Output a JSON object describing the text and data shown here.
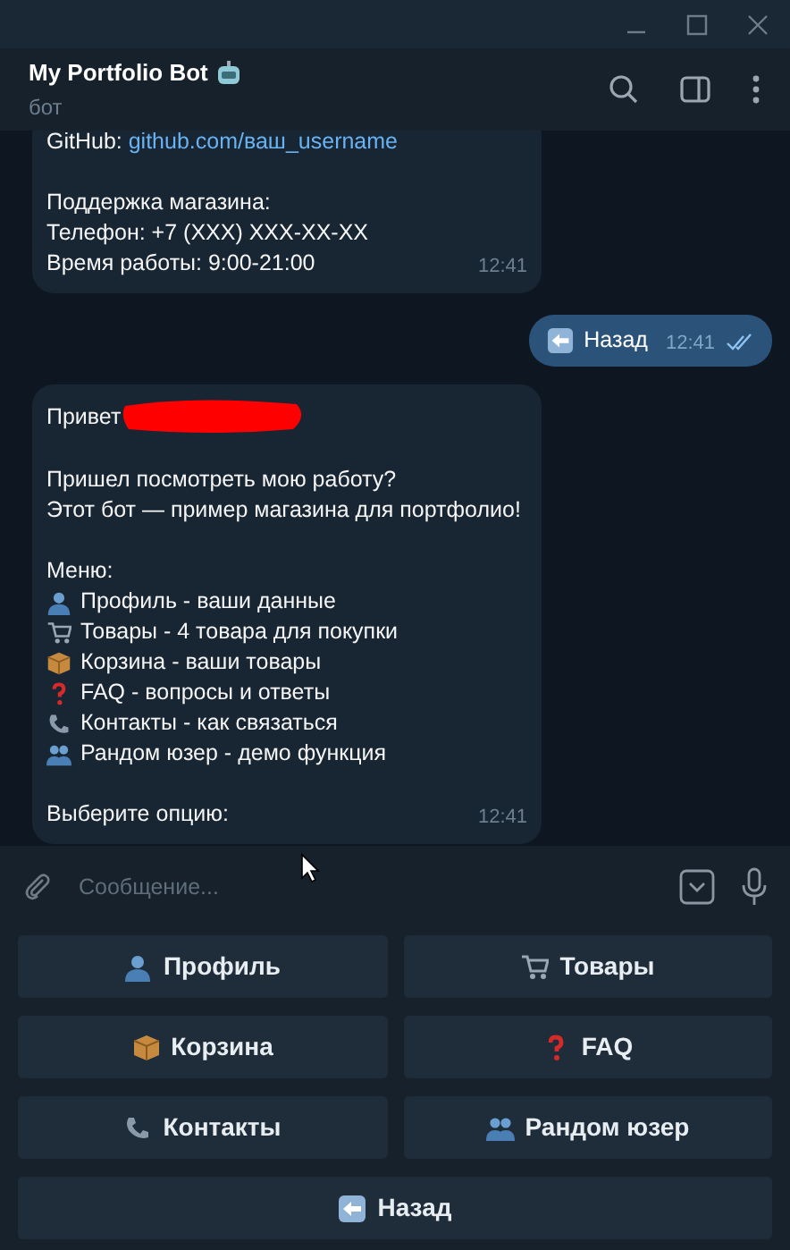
{
  "chat": {
    "title": "My Portfolio Bot",
    "subtitle": "бот"
  },
  "messages": [
    {
      "kind": "incoming",
      "paragraphs": [
        {
          "kind": "text",
          "lines": [
            {
              "text": "GitHub: ",
              "link": "github.com/ваш_username"
            }
          ]
        },
        {
          "kind": "text",
          "lines": [
            {
              "text": "Поддержка магазина:"
            },
            {
              "text": "Телефон: +7 (XXX) XXX-XX-XX"
            },
            {
              "text": "Время работы: 9:00-21:00"
            }
          ]
        }
      ],
      "time": "12:41"
    },
    {
      "kind": "outgoing",
      "text": "Назад",
      "time": "12:41",
      "read": true
    },
    {
      "kind": "incoming",
      "paragraphs": [
        {
          "kind": "greeting",
          "text": "Привет",
          "redacted": true
        },
        {
          "kind": "text",
          "lines": [
            {
              "text": "Пришел посмотреть мою работу?"
            },
            {
              "text": "Этот бот — пример магазина для портфолио!"
            }
          ]
        },
        {
          "kind": "menu",
          "title": "Меню:",
          "items": [
            "Профиль - ваши данные",
            "Товары - 4 товара для покупки",
            "Корзина - ваши товары",
            "FAQ - вопросы и ответы",
            "Контакты - как связаться",
            "Рандом юзер - демо функция"
          ]
        },
        {
          "kind": "text",
          "lines": [
            {
              "text": "Выберите опцию:"
            }
          ]
        }
      ],
      "time": "12:41"
    }
  ],
  "composer": {
    "placeholder": "Сообщение..."
  },
  "keyboard": [
    [
      "Профиль",
      "Товары"
    ],
    [
      "Корзина",
      "FAQ"
    ],
    [
      "Контакты",
      "Рандом юзер"
    ],
    [
      "Назад"
    ]
  ]
}
